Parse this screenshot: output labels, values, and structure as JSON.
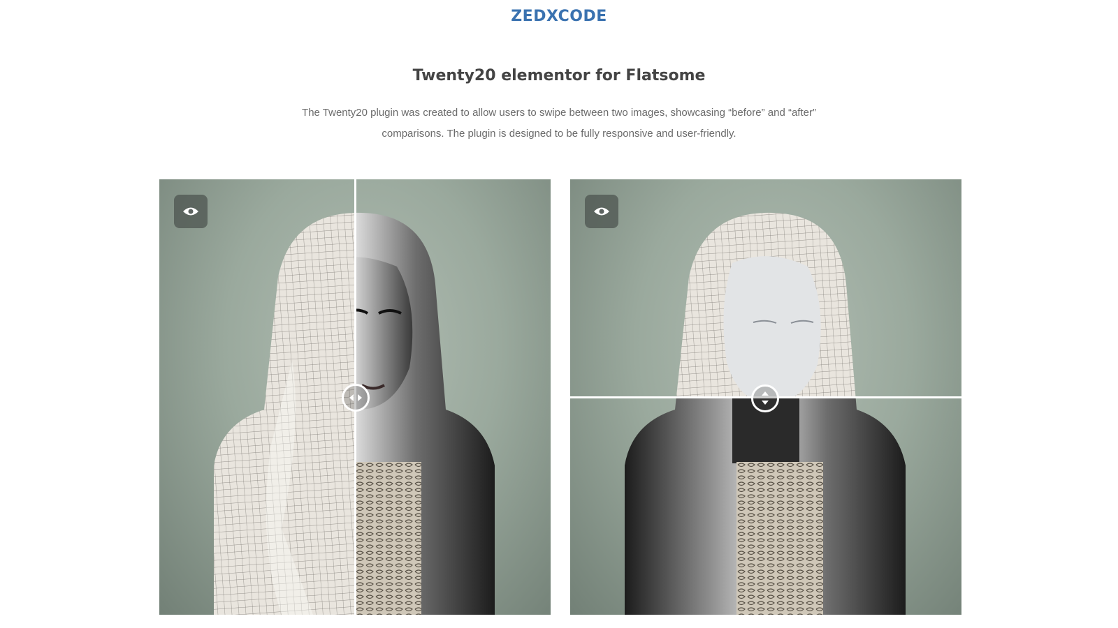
{
  "header": {
    "brand": "ZEDXCODE"
  },
  "section": {
    "title": "Twenty20 elementor for Flatsome",
    "description": "The Twenty20 plugin was created to allow users to swipe between two images, showcasing “before” and “after” comparisons. The plugin is designed to be fully responsive and user-friendly."
  },
  "comparisons": [
    {
      "orientation": "horizontal",
      "slider_position": 0.5,
      "before_image": "wireframe-mesh-bust",
      "after_image": "silver-rendered-bust",
      "toggle_icon": "eye-icon",
      "handle_icon": "left-right-arrows-icon"
    },
    {
      "orientation": "vertical",
      "slider_position": 0.5,
      "before_image": "wireframe-mesh-bust",
      "after_image": "silver-rendered-bust",
      "toggle_icon": "eye-icon",
      "handle_icon": "up-down-arrows-icon"
    }
  ],
  "colors": {
    "brand": "#3a72b0",
    "title": "#444444",
    "body_text": "#6b6b6b",
    "image_background": "#9aa99d",
    "mesh_surface": "#e9e5de",
    "render_surface": "#2f2f2f"
  }
}
